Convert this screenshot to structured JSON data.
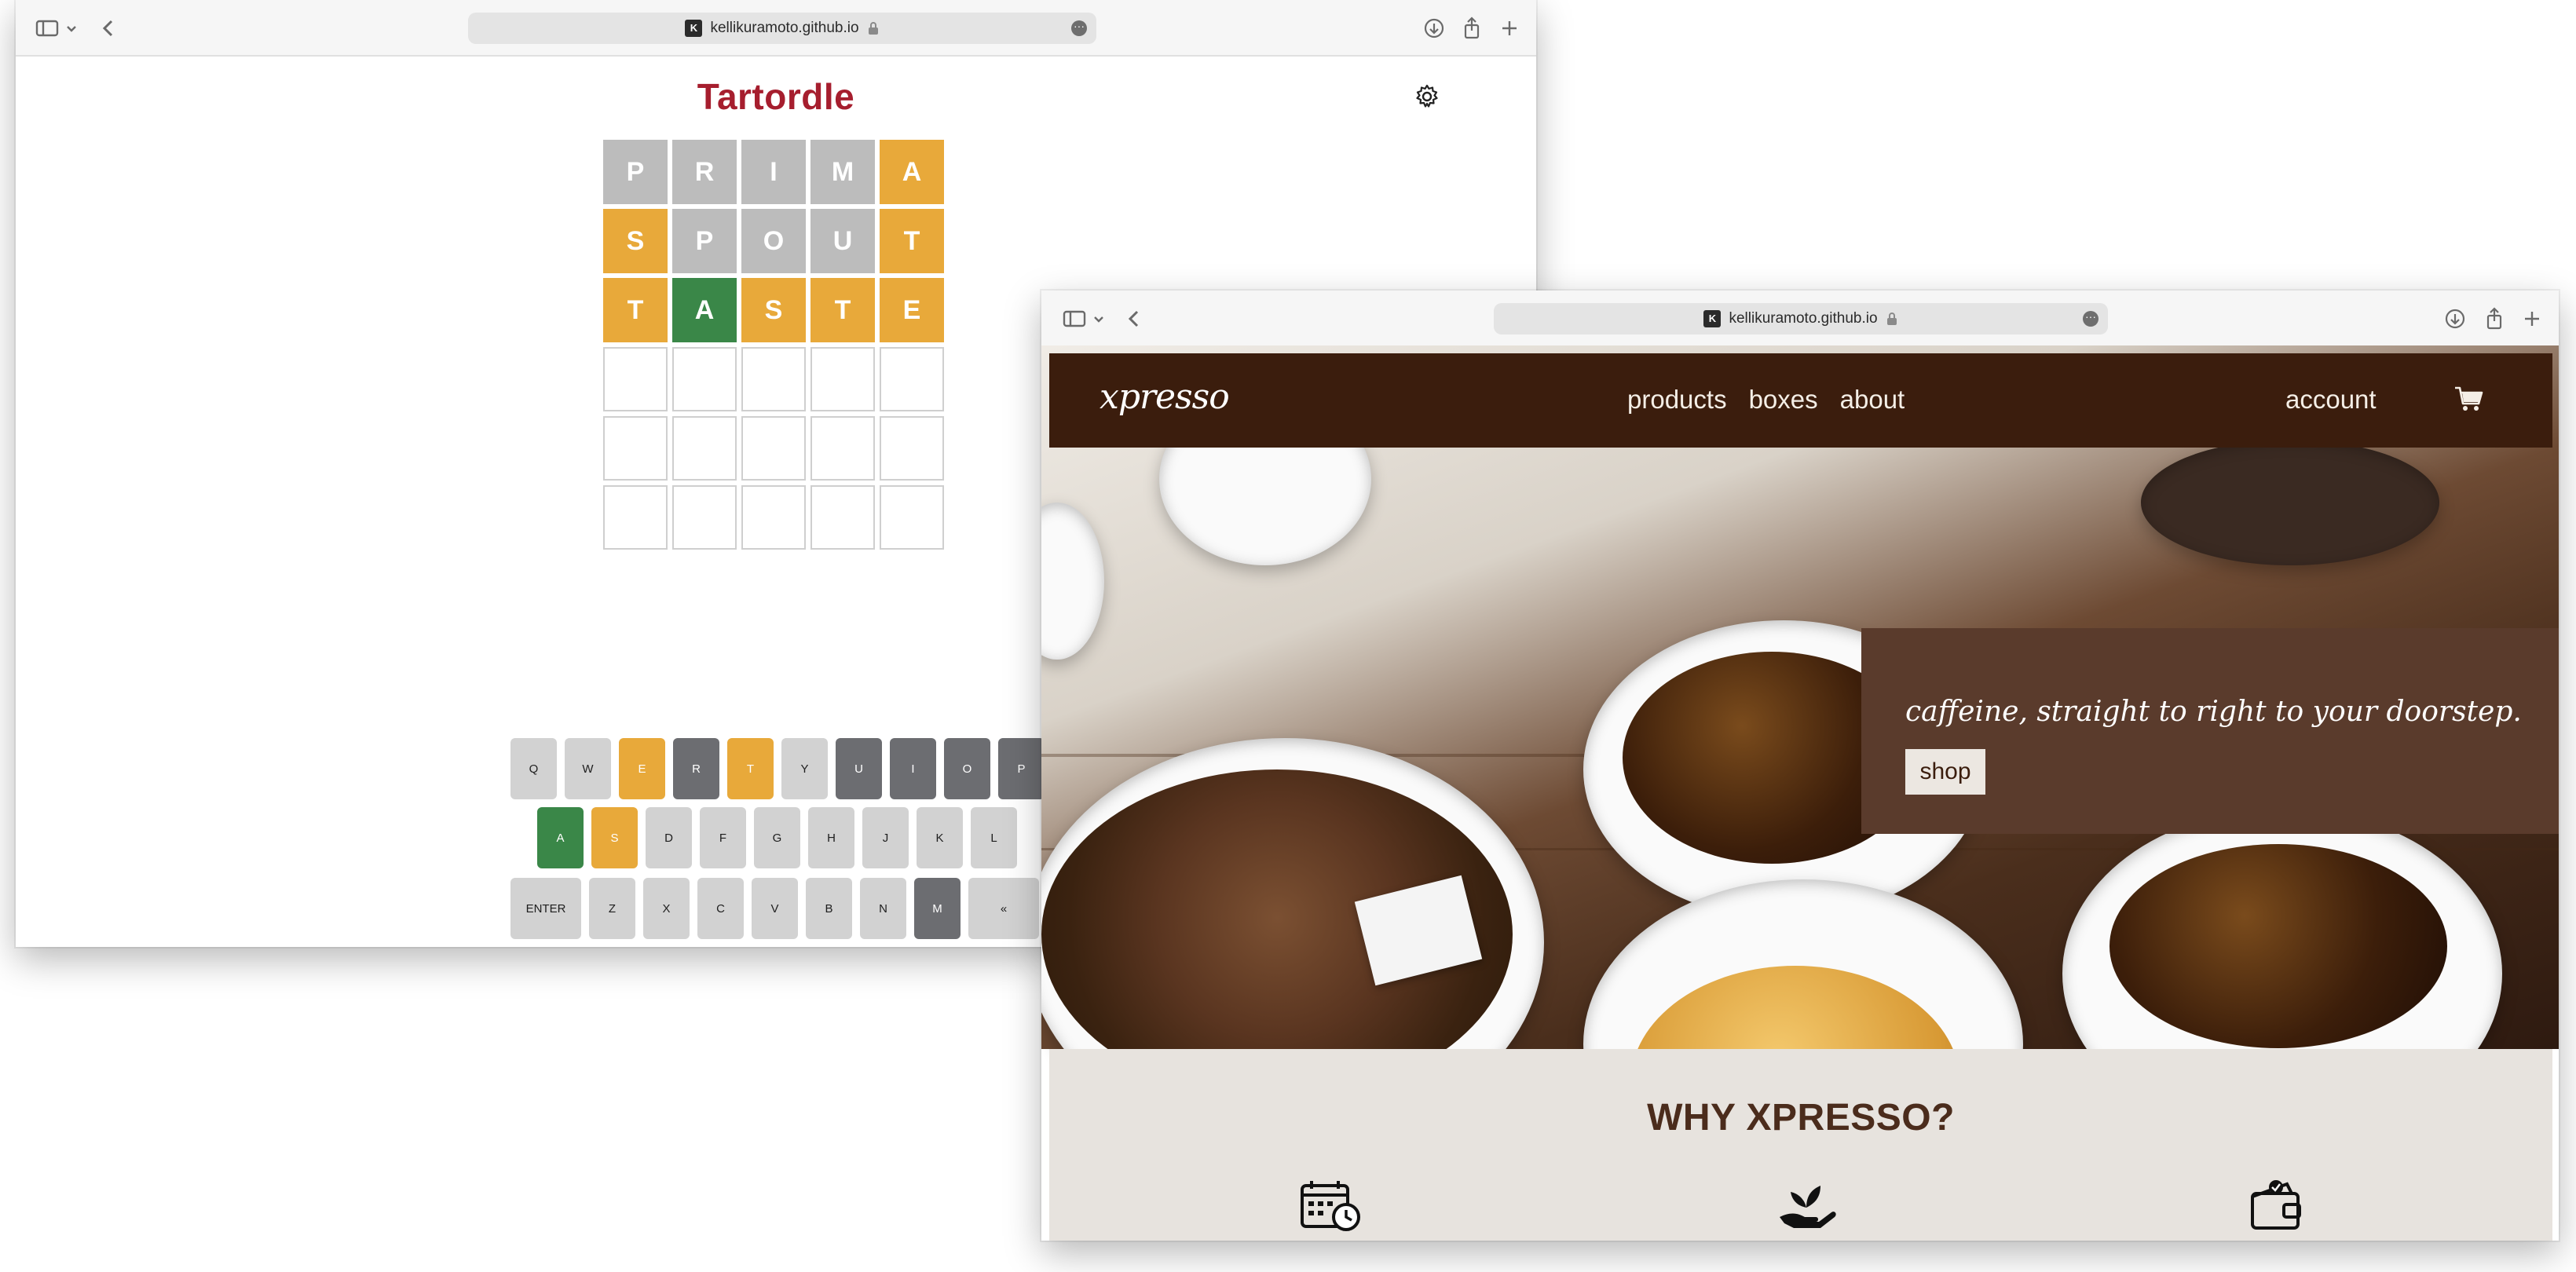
{
  "window_back": {
    "address": "kellikuramoto.github.io",
    "favicon": "K",
    "title": "Tartordle",
    "guesses": [
      [
        {
          "l": "P",
          "s": "absent"
        },
        {
          "l": "R",
          "s": "absent"
        },
        {
          "l": "I",
          "s": "absent"
        },
        {
          "l": "M",
          "s": "absent"
        },
        {
          "l": "A",
          "s": "present"
        }
      ],
      [
        {
          "l": "S",
          "s": "present"
        },
        {
          "l": "P",
          "s": "absent"
        },
        {
          "l": "O",
          "s": "absent"
        },
        {
          "l": "U",
          "s": "absent"
        },
        {
          "l": "T",
          "s": "present"
        }
      ],
      [
        {
          "l": "T",
          "s": "present"
        },
        {
          "l": "A",
          "s": "correct"
        },
        {
          "l": "S",
          "s": "present"
        },
        {
          "l": "T",
          "s": "present"
        },
        {
          "l": "E",
          "s": "present"
        }
      ],
      [
        {
          "l": "",
          "s": "empty"
        },
        {
          "l": "",
          "s": "empty"
        },
        {
          "l": "",
          "s": "empty"
        },
        {
          "l": "",
          "s": "empty"
        },
        {
          "l": "",
          "s": "empty"
        }
      ],
      [
        {
          "l": "",
          "s": "empty"
        },
        {
          "l": "",
          "s": "empty"
        },
        {
          "l": "",
          "s": "empty"
        },
        {
          "l": "",
          "s": "empty"
        },
        {
          "l": "",
          "s": "empty"
        }
      ],
      [
        {
          "l": "",
          "s": "empty"
        },
        {
          "l": "",
          "s": "empty"
        },
        {
          "l": "",
          "s": "empty"
        },
        {
          "l": "",
          "s": "empty"
        },
        {
          "l": "",
          "s": "empty"
        }
      ]
    ],
    "keyboard": {
      "row1": [
        {
          "k": "Q",
          "s": "unused"
        },
        {
          "k": "W",
          "s": "unused"
        },
        {
          "k": "E",
          "s": "present"
        },
        {
          "k": "R",
          "s": "absent"
        },
        {
          "k": "T",
          "s": "present"
        },
        {
          "k": "Y",
          "s": "unused"
        },
        {
          "k": "U",
          "s": "absent"
        },
        {
          "k": "I",
          "s": "absent"
        },
        {
          "k": "O",
          "s": "absent"
        },
        {
          "k": "P",
          "s": "absent"
        }
      ],
      "row2": [
        {
          "k": "A",
          "s": "correct"
        },
        {
          "k": "S",
          "s": "present"
        },
        {
          "k": "D",
          "s": "unused"
        },
        {
          "k": "F",
          "s": "unused"
        },
        {
          "k": "G",
          "s": "unused"
        },
        {
          "k": "H",
          "s": "unused"
        },
        {
          "k": "J",
          "s": "unused"
        },
        {
          "k": "K",
          "s": "unused"
        },
        {
          "k": "L",
          "s": "unused"
        }
      ],
      "row3": [
        {
          "k": "ENTER",
          "s": "unused",
          "wide": true
        },
        {
          "k": "Z",
          "s": "unused"
        },
        {
          "k": "X",
          "s": "unused"
        },
        {
          "k": "C",
          "s": "unused"
        },
        {
          "k": "V",
          "s": "unused"
        },
        {
          "k": "B",
          "s": "unused"
        },
        {
          "k": "N",
          "s": "unused"
        },
        {
          "k": "M",
          "s": "absent"
        },
        {
          "k": "«",
          "s": "unused",
          "wide": true
        }
      ]
    },
    "colors": {
      "title": "#a61e2e",
      "present": "#e8a93a",
      "correct": "#3a8748",
      "absent_key": "#6c6d71",
      "absent_tile": "#bcbcbc"
    }
  },
  "window_front": {
    "address": "kellikuramoto.github.io",
    "favicon": "K",
    "logo": "xpresso",
    "nav": [
      "products",
      "boxes",
      "about"
    ],
    "account": "account",
    "tagline": "caffeine, straight to right to your doorstep.",
    "shop_label": "shop",
    "why_title": "WHY XPRESSO?",
    "why_icons": [
      "calendar-clock-icon",
      "hand-plant-icon",
      "wallet-check-icon"
    ],
    "colors": {
      "nav": "#3b1d0d",
      "promo": "#5a3b2c",
      "why_bg": "#e7e3de",
      "why_title": "#4b2c1c"
    }
  }
}
